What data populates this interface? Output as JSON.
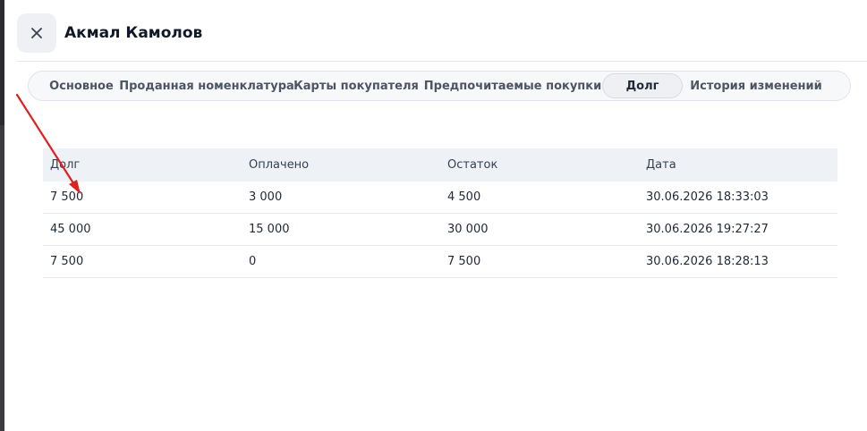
{
  "modal": {
    "title": "Акмал Камолов"
  },
  "tabs": [
    {
      "label": "Основное",
      "active": false
    },
    {
      "label": "Проданная номенклатура",
      "active": false
    },
    {
      "label": "Карты покупателя",
      "active": false
    },
    {
      "label": "Предпочитаемые покупки",
      "active": false
    },
    {
      "label": "Долг",
      "active": true
    },
    {
      "label": "История изменений",
      "active": false
    }
  ],
  "table": {
    "headers": [
      "Долг",
      "Оплачено",
      "Остаток",
      "Дата"
    ],
    "rows": [
      [
        "7 500",
        "3 000",
        "4 500",
        "30.06.2026 18:33:03"
      ],
      [
        "45 000",
        "15 000",
        "30 000",
        "30.06.2026 19:27:27"
      ],
      [
        "7 500",
        "0",
        "7 500",
        "30.06.2026 18:28:13"
      ]
    ]
  },
  "colors": {
    "annotation_arrow": "#e02020",
    "header_bg": "#eef1f6",
    "active_tab_bg": "#eef0f4"
  },
  "icons": {
    "close": "close-icon"
  }
}
